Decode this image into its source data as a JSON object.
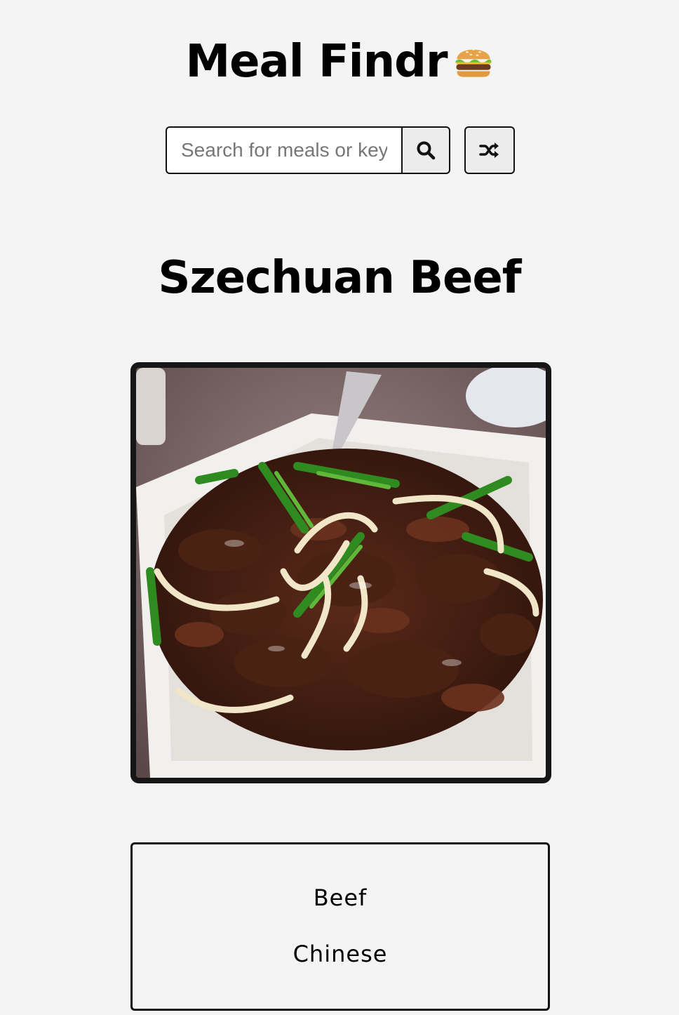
{
  "header": {
    "title": "Meal Findr",
    "emoji_icon": "burger-icon"
  },
  "search": {
    "placeholder": "Search for meals or keywords",
    "value": "",
    "search_icon": "search-icon",
    "random_icon": "shuffle-icon"
  },
  "meal": {
    "title": "Szechuan Beef",
    "image_subject": "stir-fried beef with green onions and onions on a white plate",
    "category": "Beef",
    "area": "Chinese"
  },
  "colors": {
    "background": "#f4f4f4",
    "border": "#111111",
    "button_bg": "#ececec"
  }
}
